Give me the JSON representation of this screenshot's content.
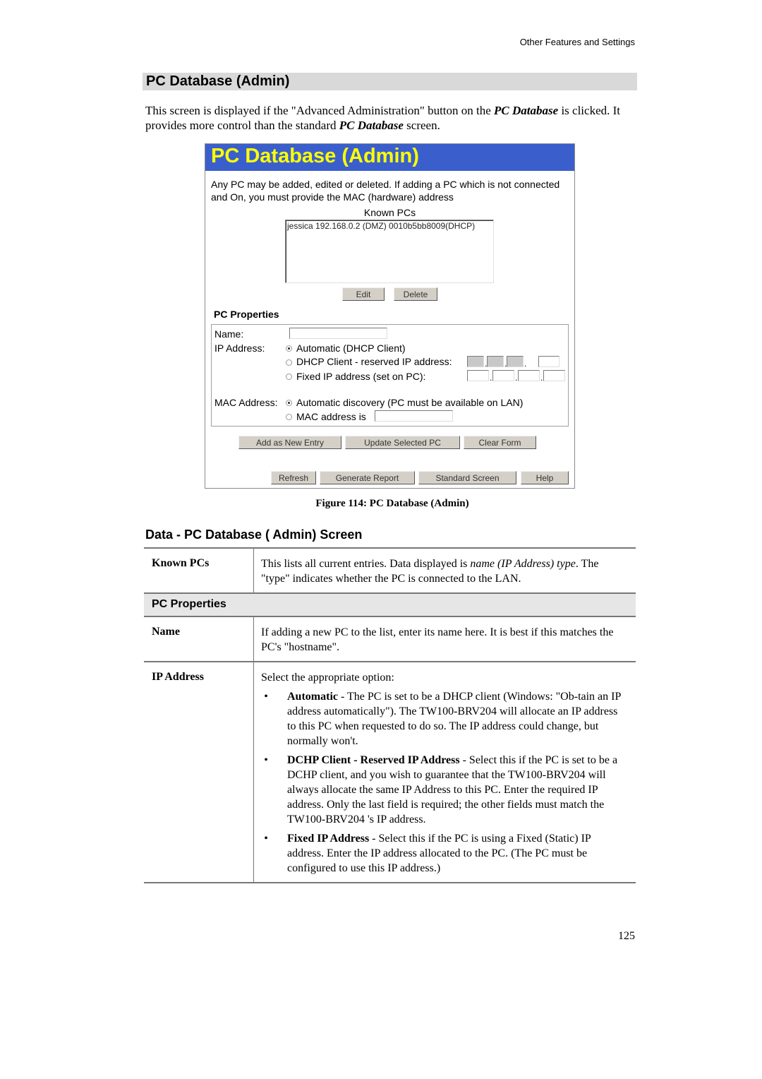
{
  "running_head": "Other Features and Settings",
  "section_title": "PC Database (Admin)",
  "intro": {
    "part1": "This screen is displayed if the \"Advanced Administration\" button on the ",
    "em1": "PC Database",
    "part2": " is clicked. It provides more control than the standard ",
    "em2": "PC Database",
    "part3": " screen."
  },
  "screenshot": {
    "title": "PC Database (Admin)",
    "description": "Any PC may be added, edited or deleted. If adding a PC which is not connected and On, you must provide the MAC (hardware) address",
    "known_pcs_label": "Known PCs",
    "known_pcs": [
      "jessica 192.168.0.2 (DMZ) 0010b5bb8009(DHCP)"
    ],
    "edit_label": "Edit",
    "delete_label": "Delete",
    "properties_label": "PC Properties",
    "name_label": "Name:",
    "name_value": "",
    "ip_label": "IP Address:",
    "ip_options": {
      "automatic": "Automatic (DHCP Client)",
      "reserved": "DHCP Client - reserved IP address:",
      "fixed": "Fixed IP address (set on PC):"
    },
    "ip_selected": "automatic",
    "mac_label": "MAC Address:",
    "mac_options": {
      "automatic": "Automatic discovery (PC must be available on LAN)",
      "manual": "MAC address is"
    },
    "mac_selected": "automatic",
    "mac_value": "",
    "buttons": {
      "add": "Add as New Entry",
      "update": "Update Selected PC",
      "clear": "Clear Form",
      "refresh": "Refresh",
      "report": "Generate Report",
      "standard": "Standard Screen",
      "help": "Help"
    }
  },
  "figure_caption": "Figure 114: PC Database (Admin)",
  "subsection_title": "Data - PC Database ( Admin) Screen",
  "table": {
    "known_pcs": {
      "label": "Known PCs",
      "text1": "This lists all current entries. Data displayed is ",
      "em": "name (IP Address) type",
      "text2": ". The \"type\" indicates whether the PC is connected to the LAN."
    },
    "group_header": "PC Properties",
    "name": {
      "label": "Name",
      "text": "If adding a new PC to the list, enter its name here. It is best if this matches the PC's \"hostname\"."
    },
    "ip_address": {
      "label": "IP Address",
      "intro": "Select the appropriate option:",
      "bullets": [
        {
          "term": "Automatic",
          "text": " - The PC is set to be a DHCP client (Windows: \"Ob-tain an IP address automatically\"). The TW100-BRV204  will allocate an IP address to this PC when requested to do so. The IP address could change, but normally won't."
        },
        {
          "term": "DCHP Client - Reserved IP Address",
          "text": " - Select this if the PC is set to be a DCHP client, and you wish to guarantee that the TW100-BRV204  will always allocate the same IP Address to this PC. Enter the required IP address. Only the last field is required; the other fields must match the TW100-BRV204  's IP address."
        },
        {
          "term": "Fixed IP Address",
          "text": " - Select this if the PC is using a Fixed (Static) IP address. Enter the IP address allocated to the PC. (The PC must be configured to use this IP address.)"
        }
      ]
    }
  },
  "page_number": "125"
}
